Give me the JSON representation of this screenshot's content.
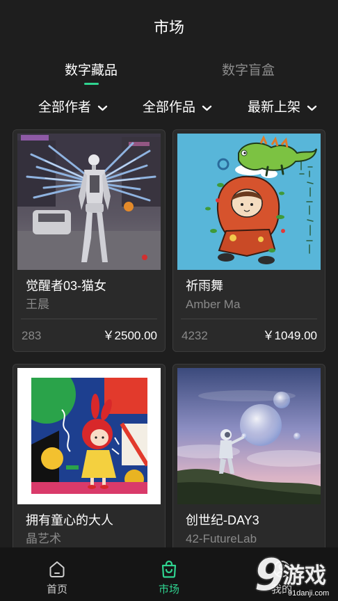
{
  "header": {
    "title": "市场"
  },
  "tabs": [
    {
      "label": "数字藏品",
      "active": true
    },
    {
      "label": "数字盲盒",
      "active": false
    }
  ],
  "filters": [
    {
      "label": "全部作者",
      "icon": "chevron-down-icon"
    },
    {
      "label": "全部作品",
      "icon": "chevron-down-icon"
    },
    {
      "label": "最新上架",
      "icon": "chevron-down-icon"
    }
  ],
  "items": [
    {
      "title": "觉醒者03-猫女",
      "author": "王晨",
      "count": "283",
      "price": "￥2500.00"
    },
    {
      "title": "祈雨舞",
      "author": "Amber Ma",
      "count": "4232",
      "price": "￥1049.00"
    },
    {
      "title": "拥有童心的大人",
      "author": "晶艺术"
    },
    {
      "title": "创世纪-DAY3",
      "author": "42-FutureLab"
    }
  ],
  "nav": [
    {
      "label": "首页",
      "icon": "home-icon",
      "active": false
    },
    {
      "label": "市场",
      "icon": "shopping-bag-icon",
      "active": true
    },
    {
      "label": "我的",
      "icon": "user-icon",
      "active": false
    }
  ],
  "watermark": {
    "nine": "9",
    "name": "游戏",
    "domain": "91danji.com"
  },
  "colors": {
    "background": "#1e1e1e",
    "card": "#2a2a2a",
    "accent": "#2fd490",
    "muted": "#8a8a8a",
    "nav_background": "#151515"
  }
}
